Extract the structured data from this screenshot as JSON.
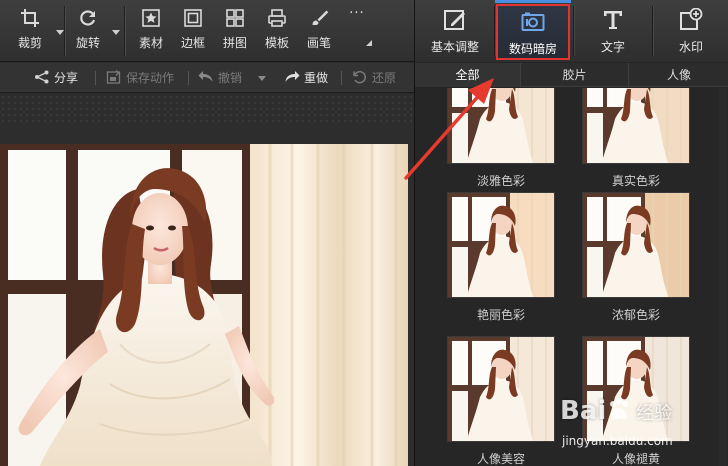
{
  "toolbar": {
    "crop": "裁剪",
    "rotate": "旋转",
    "material": "素材",
    "border": "边框",
    "collage": "拼图",
    "template": "模板",
    "brush": "画笔",
    "more": "···"
  },
  "actions": {
    "share": "分享",
    "save_action": "保存动作",
    "undo": "撤销",
    "redo": "重做",
    "restore": "还原"
  },
  "right_tabs": {
    "basic": "基本调整",
    "darkroom": "数码暗房",
    "text": "文字",
    "watermark": "水印"
  },
  "sub_tabs": {
    "all": "全部",
    "film": "胶片",
    "portrait": "人像"
  },
  "filters": [
    {
      "name": "淡雅色彩",
      "tone": "#f4e6d2"
    },
    {
      "name": "真实色彩",
      "tone": "#f1dcc3"
    },
    {
      "name": "艳丽色彩",
      "tone": "#f7dcc0"
    },
    {
      "name": "浓郁色彩",
      "tone": "#eccba8"
    },
    {
      "name": "人像美容",
      "tone": "#f6e8d8"
    },
    {
      "name": "人像褪黄",
      "tone": "#efe6dc"
    }
  ],
  "watermark": {
    "logo": "Bai",
    "logo_suffix": "经验",
    "url": "jingyan.baidu.com"
  },
  "colors": {
    "accent": "#4a90e2",
    "highlight": "#e23333"
  }
}
